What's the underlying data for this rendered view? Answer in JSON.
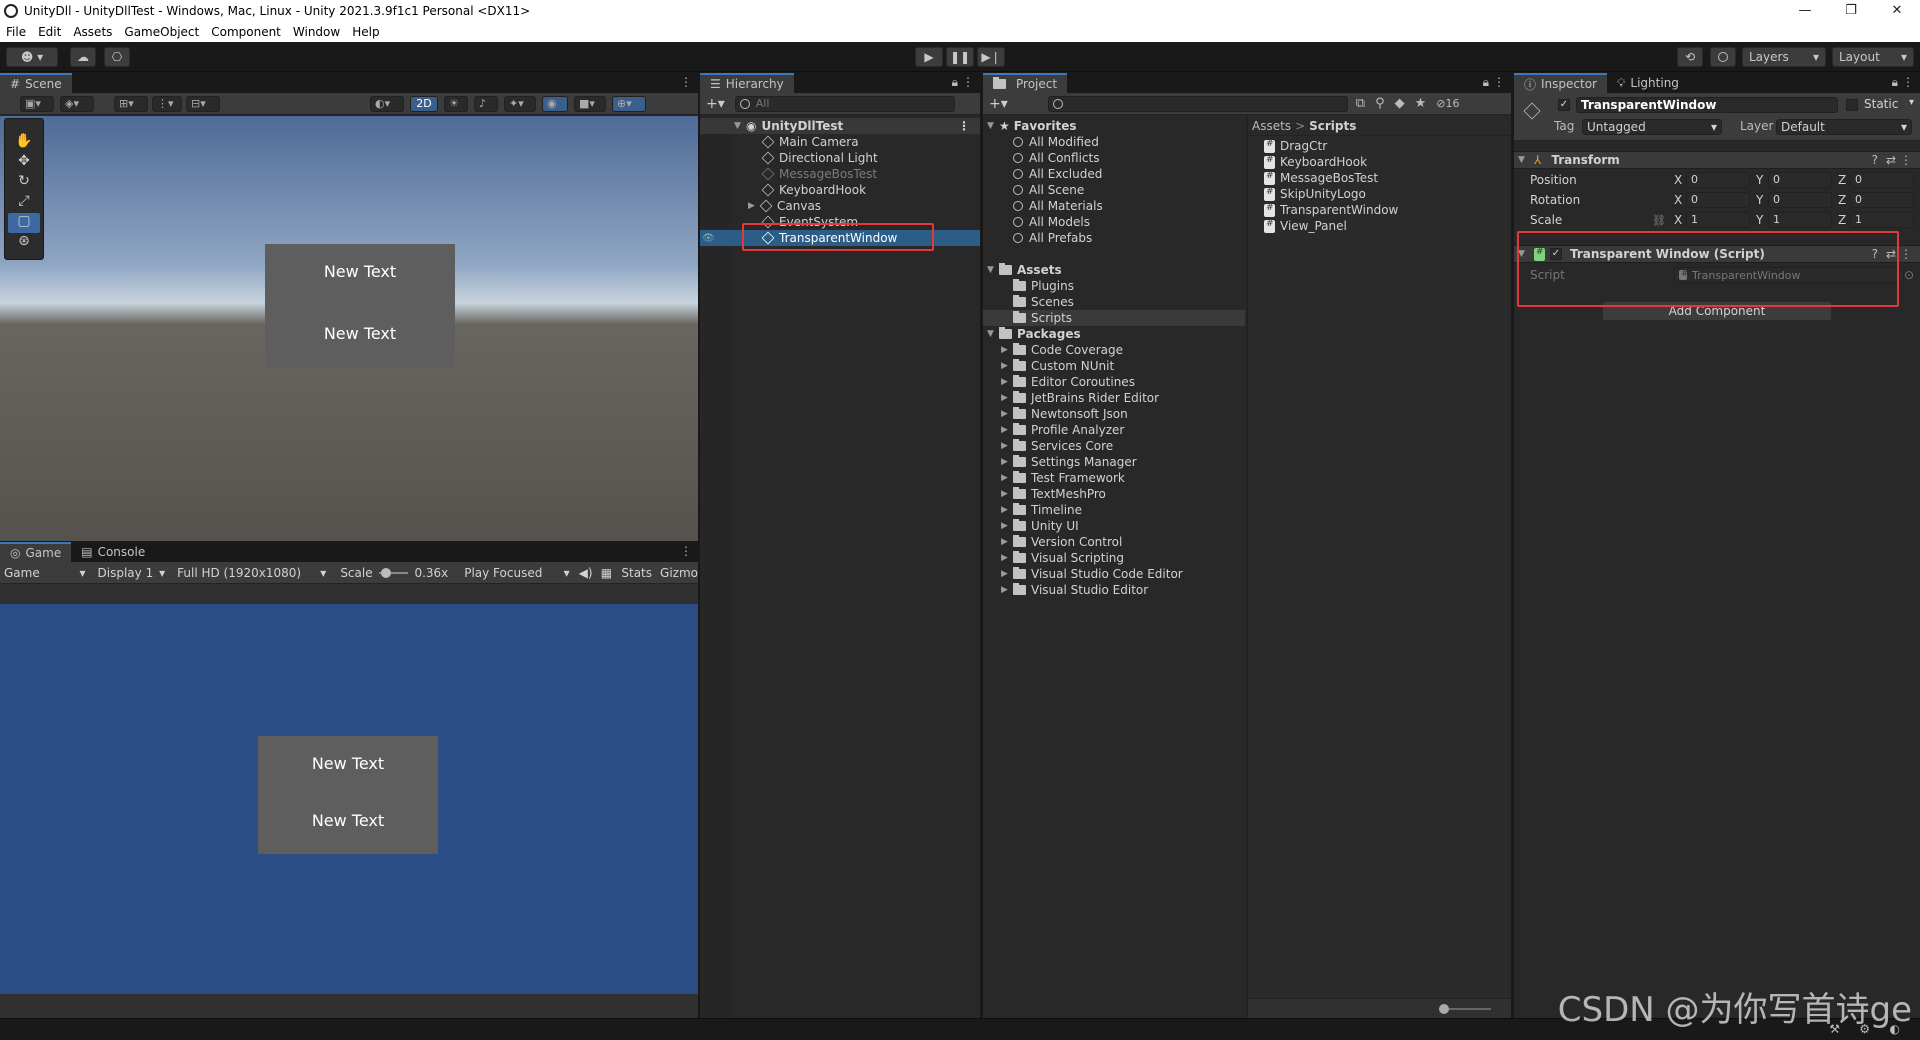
{
  "window": {
    "title": "UnityDll - UnityDllTest - Windows, Mac, Linux - Unity 2021.3.9f1c1 Personal <DX11>",
    "min": "—",
    "max": "❐",
    "close": "✕"
  },
  "menu": [
    "File",
    "Edit",
    "Assets",
    "GameObject",
    "Component",
    "Window",
    "Help"
  ],
  "toolbar": {
    "layers": "Layers",
    "layout": "Layout"
  },
  "scene": {
    "tab": "Scene",
    "mode2d": "2D",
    "texts": [
      "New Text",
      "New Text"
    ]
  },
  "game": {
    "tabs": [
      "Game",
      "Console"
    ],
    "display_target": "Game",
    "display": "Display 1",
    "resolution": "Full HD (1920x1080)",
    "scale_label": "Scale",
    "scale_value": "0.36x",
    "play_mode": "Play Focused",
    "stats": "Stats",
    "gizmos": "Gizmo",
    "texts": [
      "New Text",
      "New Text"
    ]
  },
  "hierarchy": {
    "tab": "Hierarchy",
    "search_placeholder": "All",
    "root": "UnityDllTest",
    "items": [
      "Main Camera",
      "Directional Light",
      "MessageBosTest",
      "KeyboardHook",
      "Canvas",
      "EventSystem",
      "TransparentWindow"
    ]
  },
  "project": {
    "tab": "Project",
    "hidden_count": "16",
    "favorites_label": "Favorites",
    "favorites": [
      "All Modified",
      "All Conflicts",
      "All Excluded",
      "All Scene",
      "All Materials",
      "All Models",
      "All Prefabs"
    ],
    "assets_label": "Assets",
    "assets": [
      "Plugins",
      "Scenes",
      "Scripts"
    ],
    "packages_label": "Packages",
    "packages": [
      "Code Coverage",
      "Custom NUnit",
      "Editor Coroutines",
      "JetBrains Rider Editor",
      "Newtonsoft Json",
      "Profile Analyzer",
      "Services Core",
      "Settings Manager",
      "Test Framework",
      "TextMeshPro",
      "Timeline",
      "Unity UI",
      "Version Control",
      "Visual Scripting",
      "Visual Studio Code Editor",
      "Visual Studio Editor"
    ],
    "breadcrumb": [
      "Assets",
      "Scripts"
    ],
    "breadcrumb_sep": ">",
    "files": [
      "DragCtr",
      "KeyboardHook",
      "MessageBosTest",
      "SkipUnityLogo",
      "TransparentWindow",
      "View_Panel"
    ]
  },
  "inspector": {
    "tabs": [
      "Inspector",
      "Lighting"
    ],
    "object_name": "TransparentWindow",
    "static_label": "Static",
    "tag_label": "Tag",
    "tag_value": "Untagged",
    "layer_label": "Layer",
    "layer_value": "Default",
    "transform": {
      "title": "Transform",
      "rows": [
        {
          "label": "Position",
          "x": "0",
          "y": "0",
          "z": "0"
        },
        {
          "label": "Rotation",
          "x": "0",
          "y": "0",
          "z": "0"
        },
        {
          "label": "Scale",
          "x": "1",
          "y": "1",
          "z": "1"
        }
      ],
      "axis": [
        "X",
        "Y",
        "Z"
      ]
    },
    "script_component": {
      "title": "Transparent Window (Script)",
      "script_label": "Script",
      "script_value": "TransparentWindow"
    },
    "add_component": "Add Component"
  },
  "watermark": "CSDN @为你写首诗ge"
}
